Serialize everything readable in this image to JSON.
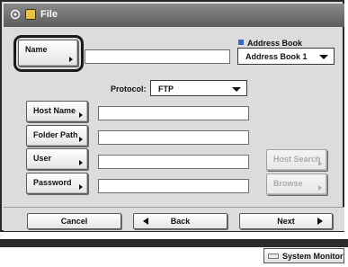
{
  "titlebar": {
    "title": "File",
    "mode_icon": "function-mode-icon",
    "file_icon": "file-folder-icon"
  },
  "name_button": {
    "label": "Name"
  },
  "address_book": {
    "label": "Address Book",
    "selected": "Address Book 1",
    "accent": "#3a64c6"
  },
  "protocol": {
    "label": "Protocol:",
    "selected": "FTP"
  },
  "fields": {
    "host_name": {
      "label": "Host Name",
      "value": ""
    },
    "folder_path": {
      "label": "Folder Path",
      "value": ""
    },
    "user": {
      "label": "User",
      "value": ""
    },
    "password": {
      "label": "Password",
      "value": ""
    }
  },
  "side_buttons": {
    "host_search": "Host Search",
    "browse": "Browse"
  },
  "nav": {
    "cancel": "Cancel",
    "back": "Back",
    "next": "Next"
  },
  "status": {
    "system_monitor": "System Monitor"
  }
}
